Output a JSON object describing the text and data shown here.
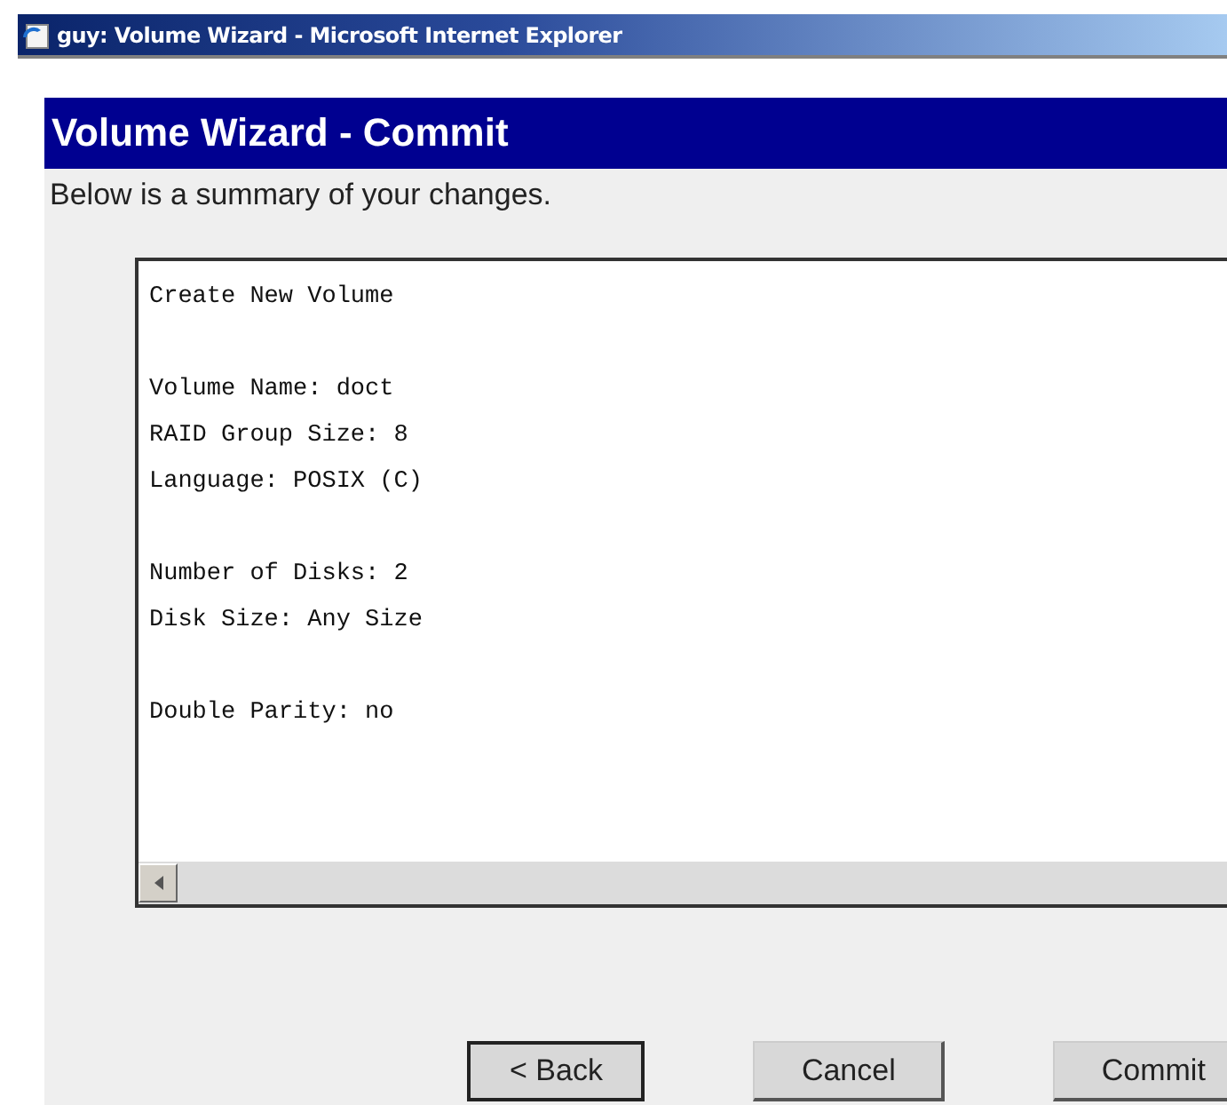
{
  "window": {
    "title": "guy: Volume Wizard - Microsoft Internet Explorer"
  },
  "header": {
    "title": "Volume Wizard - Commit"
  },
  "intro": "Below is a summary of your changes.",
  "summary_box": {
    "sections": [
      [
        "Create New Volume"
      ],
      [
        "Volume Name: doct",
        "RAID Group Size: 8",
        "Language: POSIX (C)"
      ],
      [
        "Number of Disks: 2",
        "Disk Size: Any Size"
      ],
      [
        "Double Parity: no"
      ]
    ]
  },
  "buttons": [
    {
      "label": "< Back",
      "focused": true
    },
    {
      "label": "Cancel",
      "focused": false
    },
    {
      "label": "Commit",
      "focused": false
    }
  ]
}
